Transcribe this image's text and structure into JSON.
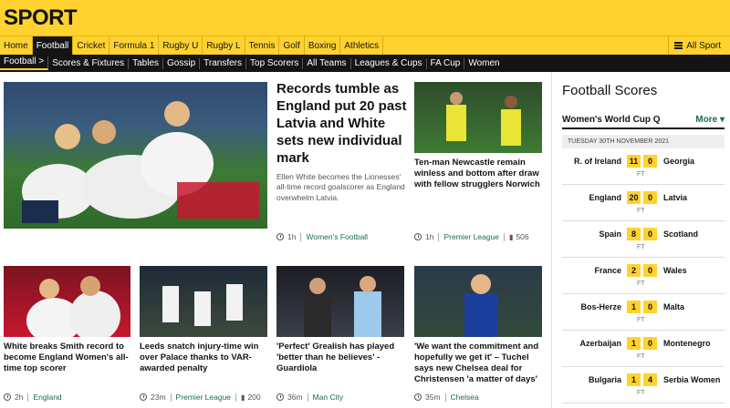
{
  "masthead": {
    "title": "SPORT"
  },
  "nav_primary": {
    "items": [
      "Home",
      "Football",
      "Cricket",
      "Formula 1",
      "Rugby U",
      "Rugby L",
      "Tennis",
      "Golf",
      "Boxing",
      "Athletics"
    ],
    "active": "Football",
    "all_sport": "All Sport"
  },
  "nav_secondary": {
    "items": [
      "Football",
      "Scores & Fixtures",
      "Tables",
      "Gossip",
      "Transfers",
      "Top Scorers",
      "All Teams",
      "Leagues & Cups",
      "FA Cup",
      "Women"
    ],
    "active": "Football",
    "active_arrow": ">"
  },
  "stories": [
    {
      "headline": "Records tumble as England put 20 past Latvia and White sets new individual mark",
      "summary": "Ellen White becomes the Lionesses' all-time record goalscorer as England overwhelm Latvia.",
      "time": "1h",
      "tag": "Women's Football"
    },
    {
      "headline": "Ten-man Newcastle remain winless and bottom after draw with fellow strugglers Norwich",
      "time": "1h",
      "tag": "Premier League",
      "comments": "506"
    },
    {
      "headline": "White breaks Smith record to become England Women's all-time top scorer",
      "time": "2h",
      "tag": "England"
    },
    {
      "headline": "Leeds snatch injury-time win over Palace thanks to VAR-awarded penalty",
      "time": "23m",
      "tag": "Premier League",
      "comments": "200"
    },
    {
      "headline": "'Perfect' Grealish has played 'better than he believes' - Guardiola",
      "time": "36m",
      "tag": "Man City"
    },
    {
      "headline": "'We want the commitment and hopefully we get it' – Tuchel says new Chelsea deal for Christensen 'a matter of days'",
      "time": "35m",
      "tag": "Chelsea"
    }
  ],
  "scores": {
    "title": "Football Scores",
    "competition": "Women's World Cup Q",
    "more": "More",
    "date": "TUESDAY 30TH NOVEMBER 2021",
    "matches": [
      {
        "home": "R. of Ireland",
        "hs": "11",
        "as": "0",
        "away": "Georgia",
        "status": "FT"
      },
      {
        "home": "England",
        "hs": "20",
        "as": "0",
        "away": "Latvia",
        "status": "FT"
      },
      {
        "home": "Spain",
        "hs": "8",
        "as": "0",
        "away": "Scotland",
        "status": "FT"
      },
      {
        "home": "France",
        "hs": "2",
        "as": "0",
        "away": "Wales",
        "status": "FT"
      },
      {
        "home": "Bos-Herze",
        "hs": "1",
        "as": "0",
        "away": "Malta",
        "status": "FT"
      },
      {
        "home": "Azerbaijan",
        "hs": "1",
        "as": "0",
        "away": "Montenegro",
        "status": "FT"
      },
      {
        "home": "Bulgaria",
        "hs": "1",
        "as": "4",
        "away": "Serbia Women",
        "status": "FT"
      }
    ]
  },
  "colors": {
    "brand": "#ffd230",
    "dark": "#141414",
    "tag": "#1a6b5a"
  }
}
